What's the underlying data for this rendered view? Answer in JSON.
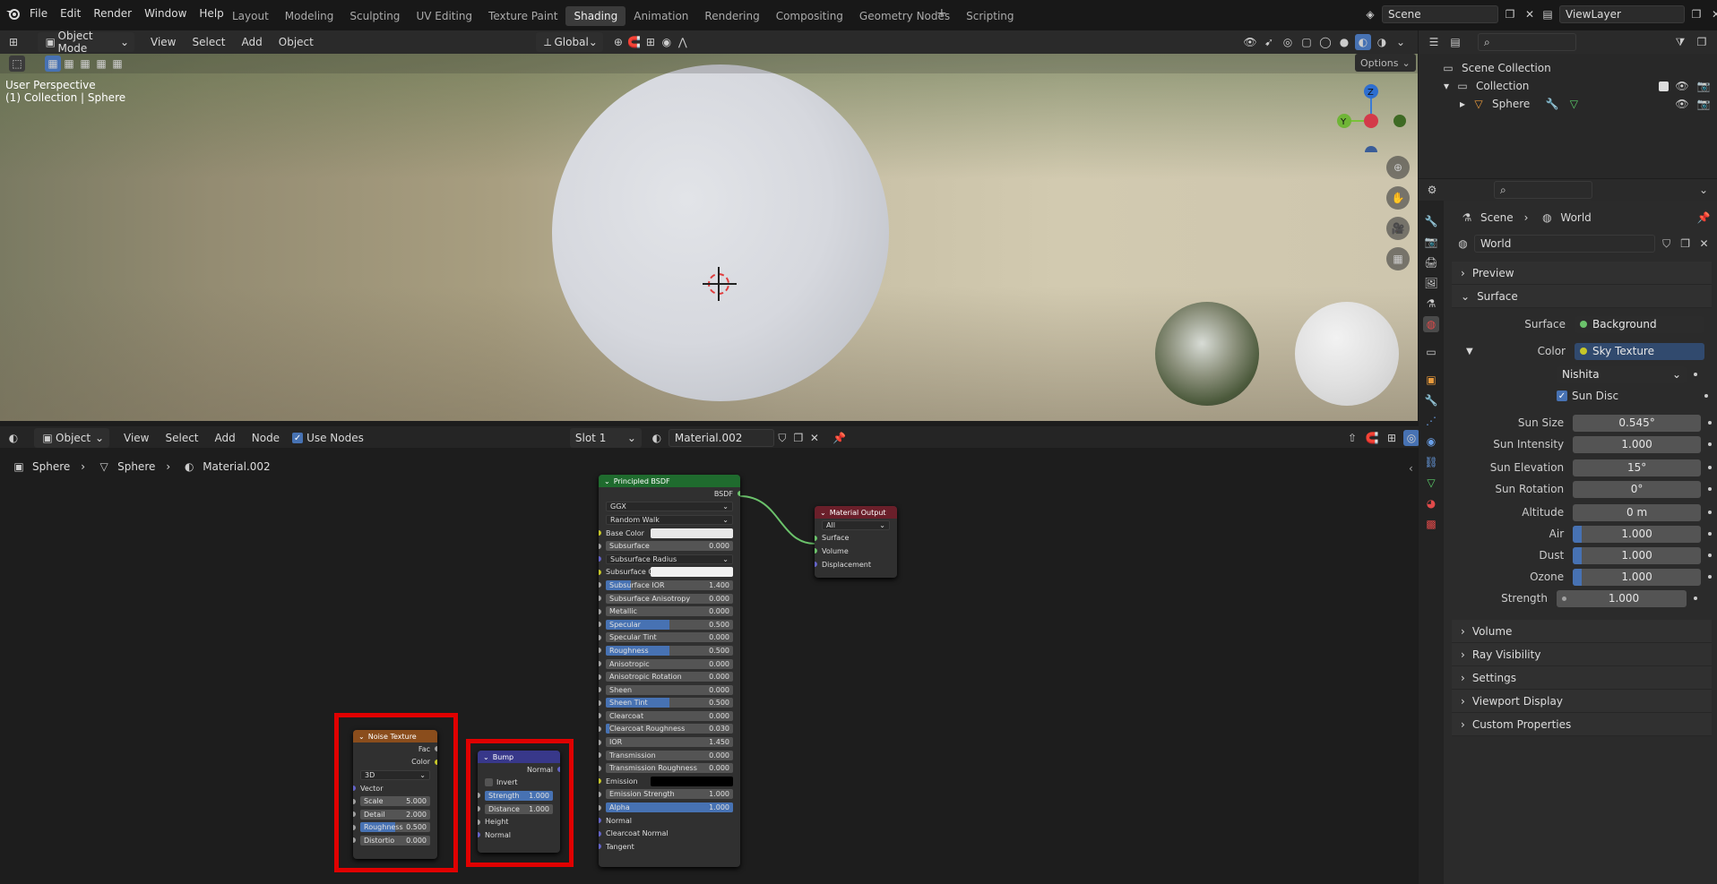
{
  "menu": [
    "File",
    "Edit",
    "Render",
    "Window",
    "Help"
  ],
  "workspaces": [
    "Layout",
    "Modeling",
    "Sculpting",
    "UV Editing",
    "Texture Paint",
    "Shading",
    "Animation",
    "Rendering",
    "Compositing",
    "Geometry Nodes",
    "Scripting"
  ],
  "active_workspace": "Shading",
  "scene_name": "Scene",
  "view_layer": "ViewLayer",
  "viewport": {
    "mode": "Object Mode",
    "menus": [
      "View",
      "Select",
      "Add",
      "Object"
    ],
    "transform": "Global",
    "options": "Options",
    "overlay_line1": "User Perspective",
    "overlay_line2": "(1) Collection | Sphere",
    "gizmo": {
      "z": "Z",
      "y": "Y"
    }
  },
  "node_editor": {
    "type": "Object",
    "menus": [
      "View",
      "Select",
      "Add",
      "Node"
    ],
    "use_nodes": "Use Nodes",
    "slot": "Slot 1",
    "material": "Material.002",
    "breadcrumb": [
      "Sphere",
      "Sphere",
      "Material.002"
    ]
  },
  "nodes": {
    "bsdf": {
      "title": "Principled BSDF",
      "output": "BSDF",
      "dist": "GGX",
      "sss": "Random Walk",
      "rows": [
        {
          "label": "Base Color",
          "type": "color",
          "color": "#e8e8e8",
          "sock": "#c7c729"
        },
        {
          "label": "Subsurface",
          "value": "0.000",
          "fill": 0,
          "sock": "#a1a1a1"
        },
        {
          "label": "Subsurface Radius",
          "type": "dd",
          "sock": "#6363c7"
        },
        {
          "label": "Subsurface C...",
          "type": "color",
          "color": "#f0f0f0",
          "sock": "#c7c729"
        },
        {
          "label": "Subsurface IOR",
          "value": "1.400",
          "fill": 0.2,
          "sock": "#a1a1a1"
        },
        {
          "label": "Subsurface Anisotropy",
          "value": "0.000",
          "fill": 0,
          "sock": "#a1a1a1"
        },
        {
          "label": "Metallic",
          "value": "0.000",
          "fill": 0,
          "sock": "#a1a1a1"
        },
        {
          "label": "Specular",
          "value": "0.500",
          "fill": 0.5,
          "sock": "#a1a1a1"
        },
        {
          "label": "Specular Tint",
          "value": "0.000",
          "fill": 0,
          "sock": "#a1a1a1"
        },
        {
          "label": "Roughness",
          "value": "0.500",
          "fill": 0.5,
          "sock": "#a1a1a1"
        },
        {
          "label": "Anisotropic",
          "value": "0.000",
          "fill": 0,
          "sock": "#a1a1a1"
        },
        {
          "label": "Anisotropic Rotation",
          "value": "0.000",
          "fill": 0,
          "sock": "#a1a1a1"
        },
        {
          "label": "Sheen",
          "value": "0.000",
          "fill": 0,
          "sock": "#a1a1a1"
        },
        {
          "label": "Sheen Tint",
          "value": "0.500",
          "fill": 0.5,
          "sock": "#a1a1a1"
        },
        {
          "label": "Clearcoat",
          "value": "0.000",
          "fill": 0,
          "sock": "#a1a1a1"
        },
        {
          "label": "Clearcoat Roughness",
          "value": "0.030",
          "fill": 0.03,
          "sock": "#a1a1a1"
        },
        {
          "label": "IOR",
          "value": "1.450",
          "fill": 0,
          "sock": "#a1a1a1"
        },
        {
          "label": "Transmission",
          "value": "0.000",
          "fill": 0,
          "sock": "#a1a1a1"
        },
        {
          "label": "Transmission Roughness",
          "value": "0.000",
          "fill": 0,
          "sock": "#a1a1a1"
        },
        {
          "label": "Emission",
          "type": "color",
          "color": "#000000",
          "sock": "#c7c729"
        },
        {
          "label": "Emission Strength",
          "value": "1.000",
          "fill": 0,
          "sock": "#a1a1a1"
        },
        {
          "label": "Alpha",
          "value": "1.000",
          "fill": 1,
          "sock": "#a1a1a1"
        },
        {
          "label": "Normal",
          "type": "plain",
          "sock": "#6363c7"
        },
        {
          "label": "Clearcoat Normal",
          "type": "plain",
          "sock": "#6363c7"
        },
        {
          "label": "Tangent",
          "type": "plain",
          "sock": "#6363c7"
        }
      ]
    },
    "output": {
      "title": "Material Output",
      "target": "All",
      "sockets": [
        "Surface",
        "Volume",
        "Displacement"
      ]
    },
    "noise": {
      "title": "Noise Texture",
      "outputs": [
        "Fac",
        "Color"
      ],
      "dim": "3D",
      "vector": "Vector",
      "rows": [
        {
          "label": "Scale",
          "value": "5.000",
          "fill": 0
        },
        {
          "label": "Detail",
          "value": "2.000",
          "fill": 0
        },
        {
          "label": "Roughness",
          "value": "0.500",
          "fill": 0.5
        },
        {
          "label": "Distortio",
          "value": "0.000",
          "fill": 0
        }
      ]
    },
    "bump": {
      "title": "Bump",
      "output": "Normal",
      "invert": "Invert",
      "rows": [
        {
          "label": "Strength",
          "value": "1.000",
          "fill": 1
        },
        {
          "label": "Distance",
          "value": "1.000",
          "fill": 0
        }
      ],
      "inputs": [
        "Height",
        "Normal"
      ]
    }
  },
  "outliner": {
    "root": "Scene Collection",
    "collection": "Collection",
    "object": "Sphere"
  },
  "properties": {
    "breadcrumb": [
      "Scene",
      "World"
    ],
    "world_name": "World",
    "panels": {
      "preview": "Preview",
      "surface": "Surface",
      "volume": "Volume",
      "ray_visibility": "Ray Visibility",
      "settings": "Settings",
      "viewport_display": "Viewport Display",
      "custom": "Custom Properties"
    },
    "surface_label": "Surface",
    "surface_value": "Background",
    "color_label": "Color",
    "color_value": "Sky Texture",
    "sky_type": "Nishita",
    "sun_disc": "Sun Disc",
    "rows": [
      {
        "label": "Sun Size",
        "value": "0.545°",
        "fill": 0
      },
      {
        "label": "Sun Intensity",
        "value": "1.000",
        "fill": 0
      },
      {
        "label": "Sun Elevation",
        "value": "15°",
        "fill": 0
      },
      {
        "label": "Sun Rotation",
        "value": "0°",
        "fill": 0
      },
      {
        "label": "Altitude",
        "value": "0 m",
        "fill": 0
      },
      {
        "label": "Air",
        "value": "1.000",
        "fill": 0.07
      },
      {
        "label": "Dust",
        "value": "1.000",
        "fill": 0.07
      },
      {
        "label": "Ozone",
        "value": "1.000",
        "fill": 0.07
      }
    ],
    "strength_label": "Strength",
    "strength_value": "1.000"
  }
}
